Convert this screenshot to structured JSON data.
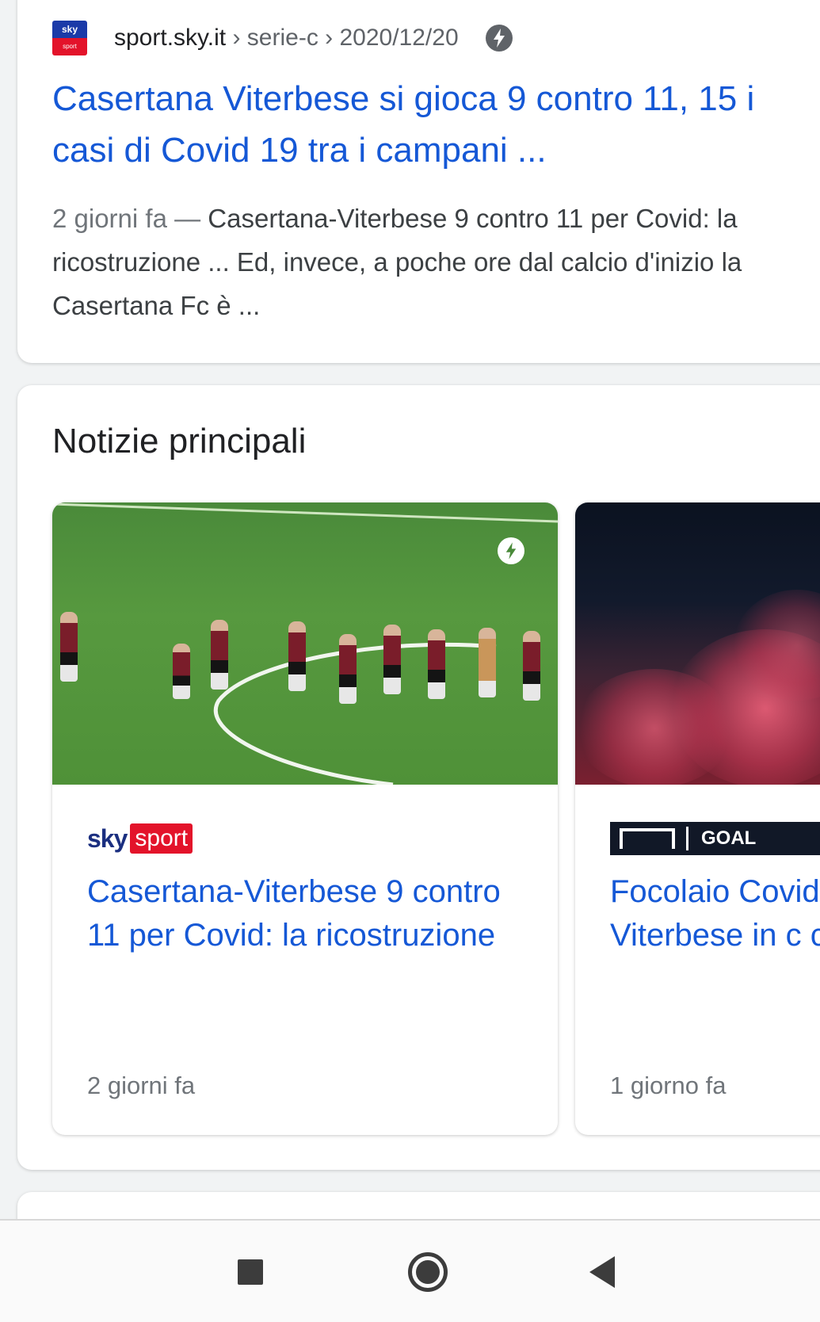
{
  "result": {
    "favicon_top": "sky",
    "favicon_bottom": "sport",
    "domain": "sport.sky.it",
    "breadcrumb": " › serie-c › 2020/12/20",
    "badge_icon": "amp-lightning-icon",
    "title": "Casertana Viterbese si gioca 9 contro 11, 15 i casi di Covid 19 tra i campani ...",
    "snippet_date": "2 giorni fa",
    "snippet_sep": " — ",
    "snippet_text": "Casertana-Viterbese 9 contro 11 per Covid: la ricostruzione ... Ed, invece, a poche ore dal calcio d'inizio la Casertana Fc è ..."
  },
  "top_stories": {
    "heading": "Notizie principali",
    "items": [
      {
        "publisher_word": "sky",
        "publisher_badge": "sport",
        "title": "Casertana-Viterbese 9 contro 11 per Covid: la ricostruzione",
        "age": "2 giorni fa",
        "image_icon": "amp-lightning-icon"
      },
      {
        "publisher_word": "GOAL",
        "title": "Focolaio Covid Casertana: co Viterbese in c calciatori",
        "age": "1 giorno fa"
      }
    ]
  },
  "navbar": {
    "recent_icon": "recent-apps-icon",
    "home_icon": "home-icon",
    "back_icon": "back-icon"
  },
  "colors": {
    "link": "#1558d6",
    "sky_blue": "#1b3aa8",
    "sky_red": "#e3132a"
  }
}
